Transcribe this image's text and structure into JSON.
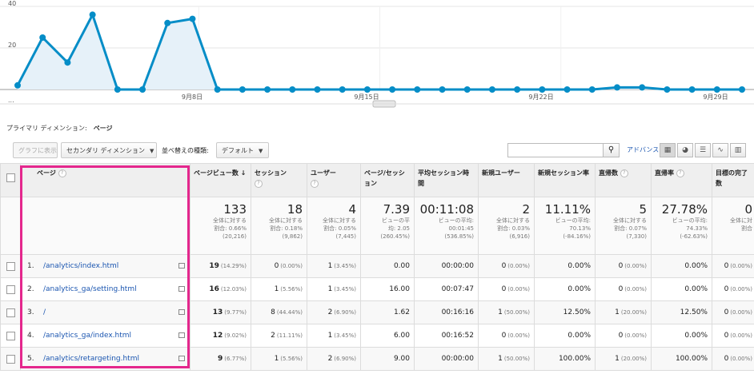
{
  "chart_data": {
    "type": "area",
    "yticks": [
      "40",
      "20",
      "..."
    ],
    "xticks": [
      "9月8日",
      "9月15日",
      "9月22日",
      "9月29日"
    ],
    "values": [
      2,
      25,
      13,
      36,
      0,
      0,
      32,
      34,
      0,
      0,
      0,
      0,
      0,
      0,
      0,
      0,
      0,
      0,
      0,
      0,
      0,
      0,
      0,
      0,
      1,
      1,
      0,
      0,
      0,
      0
    ],
    "ylim": [
      0,
      40
    ],
    "color": "#058dc7",
    "fill": "#e6f1f9",
    "grid": true
  },
  "dimension": {
    "label": "プライマリ ディメンション:",
    "value": "ページ"
  },
  "toolbar": {
    "graph_btn": "グラフに表示",
    "secondary_dim": "セカンダリ ディメンション",
    "sort_label": "並べ替えの種類:",
    "sort_value": "デフォルト",
    "search_placeholder": "",
    "advanced": "アドバンス"
  },
  "columns": [
    "ページ",
    "ページビュー数",
    "セッション",
    "ユーザー",
    "ページ/セッション",
    "平均セッション時間",
    "新規ユーザー",
    "新規セッション率",
    "直帰数",
    "直帰率",
    "目標の完了数"
  ],
  "totals": [
    {
      "big": "133",
      "l1": "全体に対する",
      "l2": "割合: 0.66%",
      "l3": "(20,216)"
    },
    {
      "big": "18",
      "l1": "全体に対する",
      "l2": "割合: 0.18%",
      "l3": "(9,862)"
    },
    {
      "big": "4",
      "l1": "全体に対する",
      "l2": "割合: 0.05%",
      "l3": "(7,445)"
    },
    {
      "big": "7.39",
      "l1": "ビューの平",
      "l2": "均: 2.05",
      "l3": "(260.45%)"
    },
    {
      "big": "00:11:08",
      "l1": "ビューの平均:",
      "l2": "00:01:45",
      "l3": "(536.85%)"
    },
    {
      "big": "2",
      "l1": "全体に対する",
      "l2": "割合: 0.03%",
      "l3": "(6,916)"
    },
    {
      "big": "11.11%",
      "l1": "ビューの平均:",
      "l2": "70.13%",
      "l3": "(-84.16%)"
    },
    {
      "big": "5",
      "l1": "全体に対する",
      "l2": "割合: 0.07%",
      "l3": "(7,330)"
    },
    {
      "big": "27.78%",
      "l1": "ビューの平均:",
      "l2": "74.33%",
      "l3": "(-62.63%)"
    },
    {
      "big": "0",
      "l1": "全体に対",
      "l2": "割合",
      "l3": ""
    }
  ],
  "rows": [
    {
      "idx": "1.",
      "page": "/analytics/index.html",
      "pv": "19",
      "pv_pct": "(14.29%)",
      "ses": "0",
      "ses_pct": "(0.00%)",
      "usr": "1",
      "usr_pct": "(3.45%)",
      "pps": "0.00",
      "dur": "00:00:00",
      "nu": "0",
      "nu_pct": "(0.00%)",
      "nsr": "0.00%",
      "bn": "0",
      "bn_pct": "(0.00%)",
      "br": "0.00%",
      "goal": "0",
      "goal_pct": "(0.00%)"
    },
    {
      "idx": "2.",
      "page": "/analytics_ga/setting.html",
      "pv": "16",
      "pv_pct": "(12.03%)",
      "ses": "1",
      "ses_pct": "(5.56%)",
      "usr": "1",
      "usr_pct": "(3.45%)",
      "pps": "16.00",
      "dur": "00:07:47",
      "nu": "0",
      "nu_pct": "(0.00%)",
      "nsr": "0.00%",
      "bn": "0",
      "bn_pct": "(0.00%)",
      "br": "0.00%",
      "goal": "0",
      "goal_pct": "(0.00%)"
    },
    {
      "idx": "3.",
      "page": "/",
      "pv": "13",
      "pv_pct": "(9.77%)",
      "ses": "8",
      "ses_pct": "(44.44%)",
      "usr": "2",
      "usr_pct": "(6.90%)",
      "pps": "1.62",
      "dur": "00:16:16",
      "nu": "1",
      "nu_pct": "(50.00%)",
      "nsr": "12.50%",
      "bn": "1",
      "bn_pct": "(20.00%)",
      "br": "12.50%",
      "goal": "0",
      "goal_pct": "(0.00%)"
    },
    {
      "idx": "4.",
      "page": "/analytics_ga/index.html",
      "pv": "12",
      "pv_pct": "(9.02%)",
      "ses": "2",
      "ses_pct": "(11.11%)",
      "usr": "1",
      "usr_pct": "(3.45%)",
      "pps": "6.00",
      "dur": "00:16:52",
      "nu": "0",
      "nu_pct": "(0.00%)",
      "nsr": "0.00%",
      "bn": "0",
      "bn_pct": "(0.00%)",
      "br": "0.00%",
      "goal": "0",
      "goal_pct": "(0.00%)"
    },
    {
      "idx": "5.",
      "page": "/analytics/retargeting.html",
      "pv": "9",
      "pv_pct": "(6.77%)",
      "ses": "1",
      "ses_pct": "(5.56%)",
      "usr": "2",
      "usr_pct": "(6.90%)",
      "pps": "9.00",
      "dur": "00:00:00",
      "nu": "1",
      "nu_pct": "(50.00%)",
      "nsr": "100.00%",
      "bn": "1",
      "bn_pct": "(20.00%)",
      "br": "100.00%",
      "goal": "0",
      "goal_pct": "(0.00%)"
    }
  ],
  "colors": {
    "highlight": "#e4278d",
    "link": "#1a55b0",
    "line": "#058dc7"
  }
}
